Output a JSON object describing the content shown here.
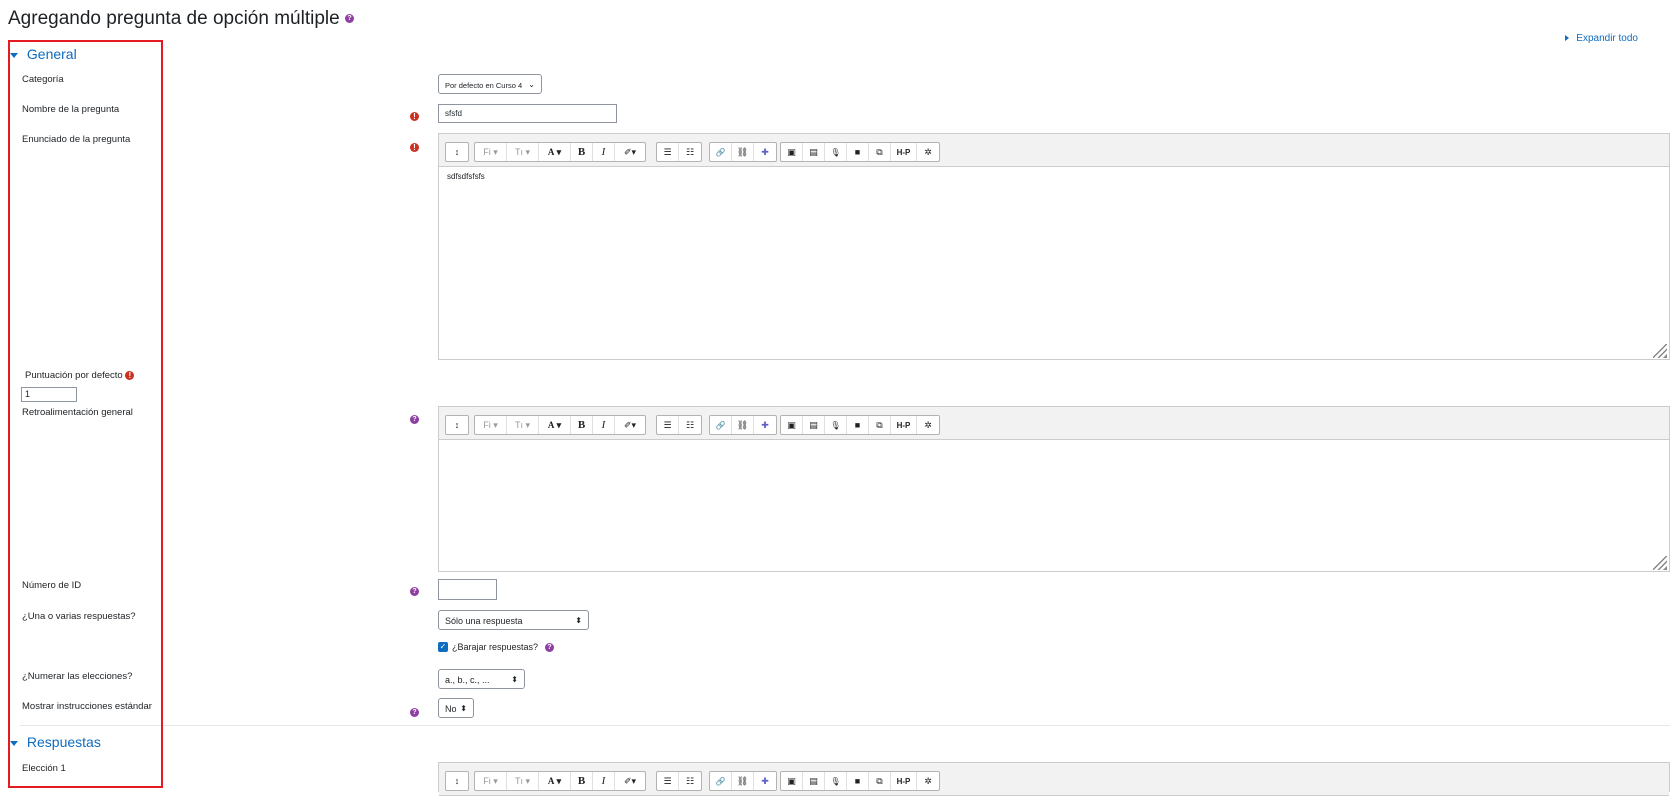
{
  "page": {
    "title": "Agregando pregunta de opción múltiple"
  },
  "expand_all": "Expandir todo",
  "sections": {
    "general": "General",
    "answers": "Respuestas"
  },
  "fields": {
    "category": {
      "label": "Categoría",
      "value": "Por defecto en Curso 4"
    },
    "question_name": {
      "label": "Nombre de la pregunta",
      "value": "sfsfd"
    },
    "question_text": {
      "label": "Enunciado de la pregunta",
      "value": "sdfsdfsfsfs"
    },
    "default_mark": {
      "label": "Puntuación por defecto",
      "value": "1"
    },
    "general_feedback": {
      "label": "Retroalimentación general",
      "value": ""
    },
    "id_number": {
      "label": "Número de ID",
      "value": ""
    },
    "single_multiple": {
      "label": "¿Una o varias respuestas?",
      "value": "Sólo una respuesta"
    },
    "shuffle": {
      "label": "¿Barajar respuestas?",
      "checked": true
    },
    "numbering": {
      "label": "¿Numerar las elecciones?",
      "value": "a., b., c., ..."
    },
    "standard_instructions": {
      "label": "Mostrar instrucciones estándar",
      "value": "No"
    },
    "choice1": {
      "label": "Elección 1"
    }
  },
  "toolbar": {
    "collapse": "↕",
    "font": "Fi",
    "size": "Tı",
    "color": "A",
    "bold": "B",
    "italic": "I",
    "highlight": "✐",
    "ul": "☰",
    "ol": "☷",
    "link": "🔗",
    "unlink": "⛓",
    "teams": "✚",
    "image": "▣",
    "media": "▤",
    "record_audio": "🎙",
    "record_video": "■",
    "manage_files": "⧉",
    "h5p": "H-P",
    "more": "✲"
  },
  "colors": {
    "accent": "#0f6cbf",
    "required": "#ca3120",
    "help": "#8f3fa1",
    "highlight_box": "#e31b23"
  }
}
